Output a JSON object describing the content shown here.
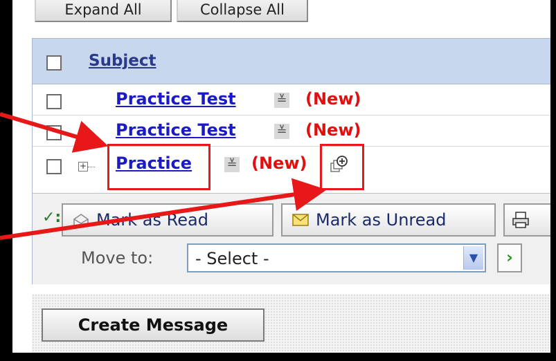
{
  "toolbar_top": {
    "expand_all": "Expand All",
    "collapse_all": "Collapse All"
  },
  "table": {
    "header": {
      "subject": "Subject"
    },
    "rows": [
      {
        "subject": "Practice Test",
        "status": "(New)",
        "expandable": false
      },
      {
        "subject": "Practice Test",
        "status": "(New)",
        "expandable": false
      },
      {
        "subject": "Practice",
        "status": "(New)",
        "expandable": true
      }
    ]
  },
  "actions": {
    "select_all_mark": "✓:",
    "mark_read": "Mark as Read",
    "mark_unread": "Mark as Unread",
    "move_to_label": "Move to:",
    "move_to_value": "- Select -"
  },
  "footer": {
    "create_message": "Create Message"
  },
  "colors": {
    "annotation": "#e81818",
    "header_bg": "#c8d6ee",
    "link": "#1a1ac8",
    "new_tag": "#e01010"
  },
  "icons": [
    "menu-icon",
    "expand-plus-icon",
    "add-reply-icon",
    "envelope-open-icon",
    "envelope-icon",
    "print-icon",
    "go-arrow-icon",
    "dropdown-arrow-icon"
  ]
}
